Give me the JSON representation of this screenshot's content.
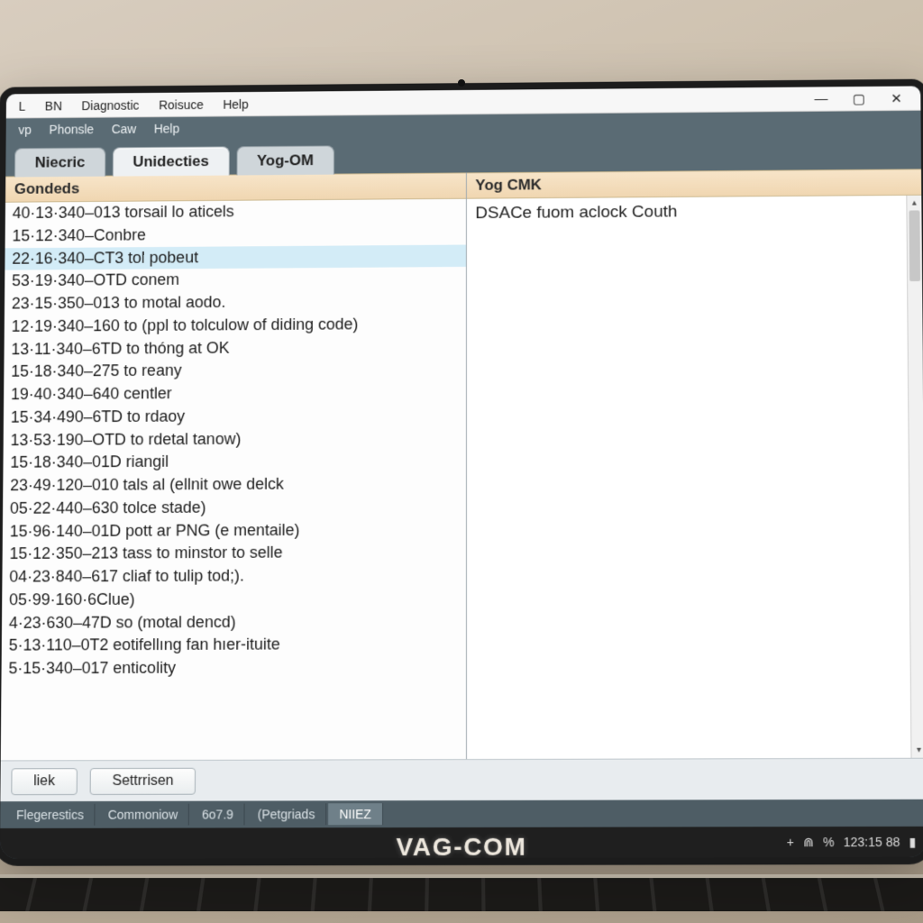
{
  "menubar1": {
    "items": [
      "L",
      "BN",
      "Diagnostic",
      "Roisuce",
      "Help"
    ]
  },
  "menubar2": {
    "items": [
      "vp",
      "Phonsle",
      "Caw",
      "Help"
    ]
  },
  "tabs": [
    {
      "label": "Niecric",
      "active": false
    },
    {
      "label": "Unidecties",
      "active": true
    },
    {
      "label": "Yog-OM",
      "active": false
    }
  ],
  "left_panel": {
    "header": "Gondeds",
    "selected_index": 2,
    "rows": [
      "40·13·340–013 torsail lo aticels",
      "15·12·340–Conbre",
      "22·16·340–CT3 tol pobeut",
      "53·19·340–OTD conem",
      "23·15·350–013 to motal aodo.",
      "12·19·340–160 to (ppl to tolculow of diding code)",
      "13·11·340–6TD to thóng at OK",
      "15·18·340–275 to reany",
      "19·40·340–640 centler",
      "15·34·490–6TD to rdaoy",
      "13·53·190–OTD to rdetal tanow)",
      "15·18·340–01D riangil",
      "23·49·120–010 tals al (ellnit owe delck",
      "05·22·440–630 tolce stade)",
      "15·96·140–01D pott ar PNG (e mentaile)",
      "15·12·350–213 tass to minstor to selle",
      "04·23·840–617 cliaf to tulip tod;).",
      "05·99·160·6Clue)",
      "4·23·630–47D so (motal dencd)",
      "5·13·110–0T2 eotifellıng fan hıer-ituite",
      "5·15·340–017 enticolity"
    ]
  },
  "right_panel": {
    "header": "Yog CMK",
    "body": "DSACe fuom aclock Couth"
  },
  "footer_buttons": [
    "liek",
    "Settrrisen"
  ],
  "status_tabs": [
    {
      "label": "Flegerestics",
      "active": false
    },
    {
      "label": "Commoniow",
      "active": false
    },
    {
      "label": "6o7.9",
      "active": false
    },
    {
      "label": "(Petgriads",
      "active": false
    },
    {
      "label": "NIIEZ",
      "active": true
    }
  ],
  "tray": {
    "plus": "+",
    "wifi": "⋒",
    "percent": "%",
    "clock": "123:15 88",
    "user": "▮"
  },
  "brand": "VAG-COM",
  "window_controls": {
    "min": "—",
    "max": "▢",
    "close": "✕"
  }
}
